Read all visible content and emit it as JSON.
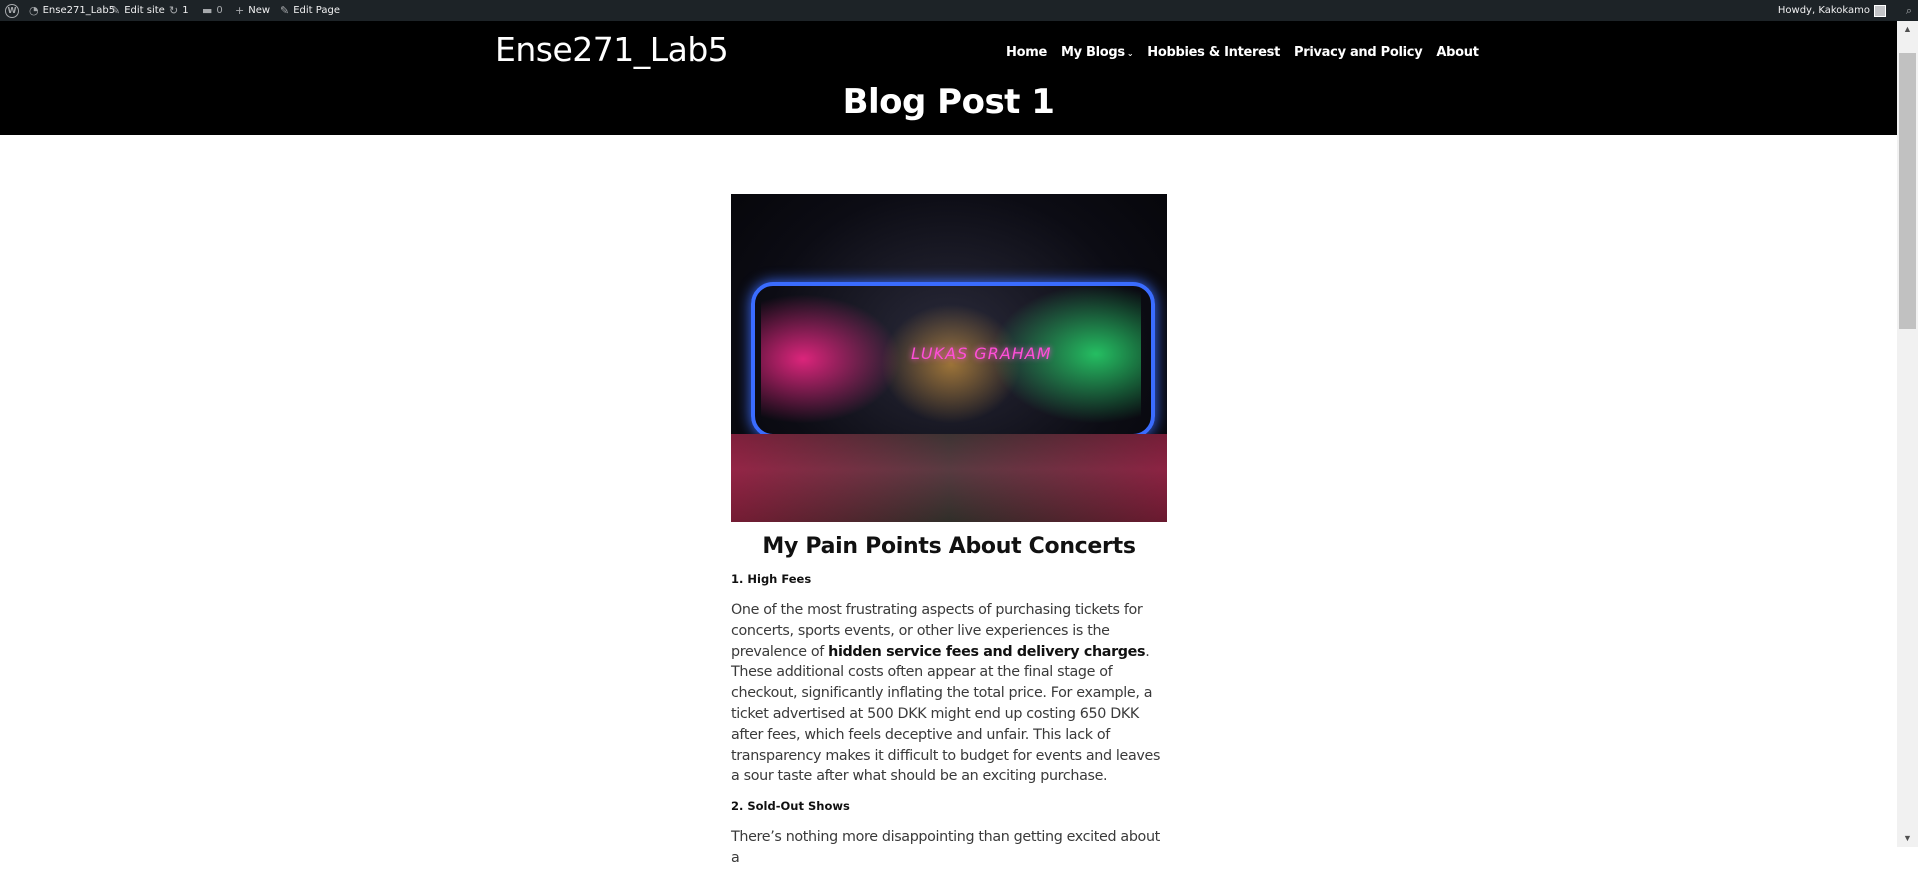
{
  "admin_bar": {
    "site_name": "Ense271_Lab5",
    "edit_site": "Edit site",
    "updates_count": "1",
    "comments_count": "0",
    "new_label": "New",
    "edit_page": "Edit Page",
    "howdy": "Howdy, Kakokamo"
  },
  "header": {
    "site_title": "Ense271_Lab5",
    "nav": {
      "home": "Home",
      "my_blogs": "My Blogs",
      "hobbies": "Hobbies & Interest",
      "privacy": "Privacy and Policy",
      "about": "About"
    },
    "page_title": "Blog Post 1"
  },
  "post": {
    "hero_sign": "LUKAS GRAHAM",
    "heading": "My Pain Points About Concerts",
    "section1_title": "1. High Fees",
    "para1_before": "One of the most frustrating aspects of purchasing tickets for concerts, sports events, or other live experiences is the prevalence of ",
    "para1_bold": "hidden service fees and delivery charges",
    "para1_after": ". These additional costs often appear at the final stage of checkout, significantly inflating the total price. For example, a ticket advertised at 500 DKK might end up costing 650 DKK after fees, which feels deceptive and unfair. This lack of transparency makes it difficult to budget for events and leaves a sour taste after what should be an exciting purchase.",
    "section2_title": "2. Sold-Out Shows",
    "para2": "There’s nothing more disappointing than getting excited about a"
  }
}
